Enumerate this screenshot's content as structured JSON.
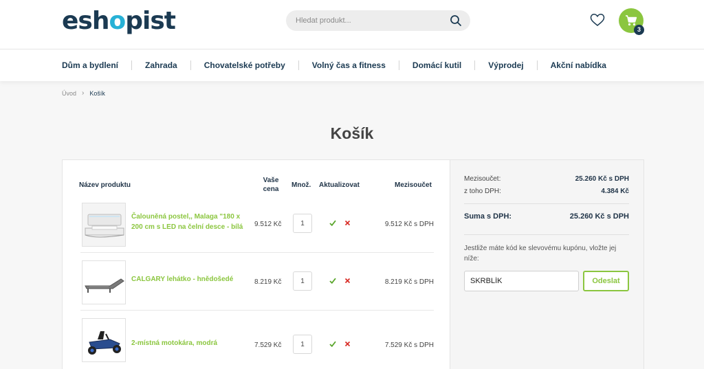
{
  "header": {
    "logo_text_1": "esh",
    "logo_text_2": "o",
    "logo_text_3": "pist",
    "search_placeholder": "Hledat produkt...",
    "cart_count": "3"
  },
  "nav": {
    "items": [
      "Dům a bydlení",
      "Zahrada",
      "Chovatelské potřeby",
      "Volný čas a fitness",
      "Domácí kutil",
      "Výprodej",
      "Akční nabídka"
    ]
  },
  "breadcrumb": {
    "home": "Úvod",
    "current": "Košík"
  },
  "page": {
    "title": "Košík"
  },
  "cart_table": {
    "headers": {
      "product": "Název produktu",
      "price": "Vaše cena",
      "qty": "Množ.",
      "update": "Aktualizovat",
      "subtotal": "Mezisoučet"
    },
    "rows": [
      {
        "name": "Čalouněná postel,, Malaga \"180 x 200 cm s LED na čelní desce - bílá",
        "price": "9.512 Kč",
        "qty": "1",
        "subtotal": "9.512 Kč s DPH"
      },
      {
        "name": "CALGARY lehátko - hnědošedé",
        "price": "8.219 Kč",
        "qty": "1",
        "subtotal": "8.219 Kč s DPH"
      },
      {
        "name": "2-místná motokára, modrá",
        "price": "7.529 Kč",
        "qty": "1",
        "subtotal": "7.529 Kč s DPH"
      }
    ]
  },
  "summary": {
    "subtotal_label": "Mezisoučet:",
    "subtotal_value": "25.260 Kč s DPH",
    "vat_label": "z toho DPH:",
    "vat_value": "4.384 Kč",
    "total_label": "Suma s DPH:",
    "total_value": "25.260 Kč s DPH",
    "coupon_text": "Jestliže máte kód ke slevovému kupónu, vložte jej níže:",
    "coupon_value": "SKRBLÍK",
    "coupon_button": "Odeslat"
  },
  "colors": {
    "brand_dark": "#1b3a52",
    "brand_green": "#8bc63f",
    "brand_blue": "#27b1d6",
    "remove_red": "#d9302a"
  }
}
